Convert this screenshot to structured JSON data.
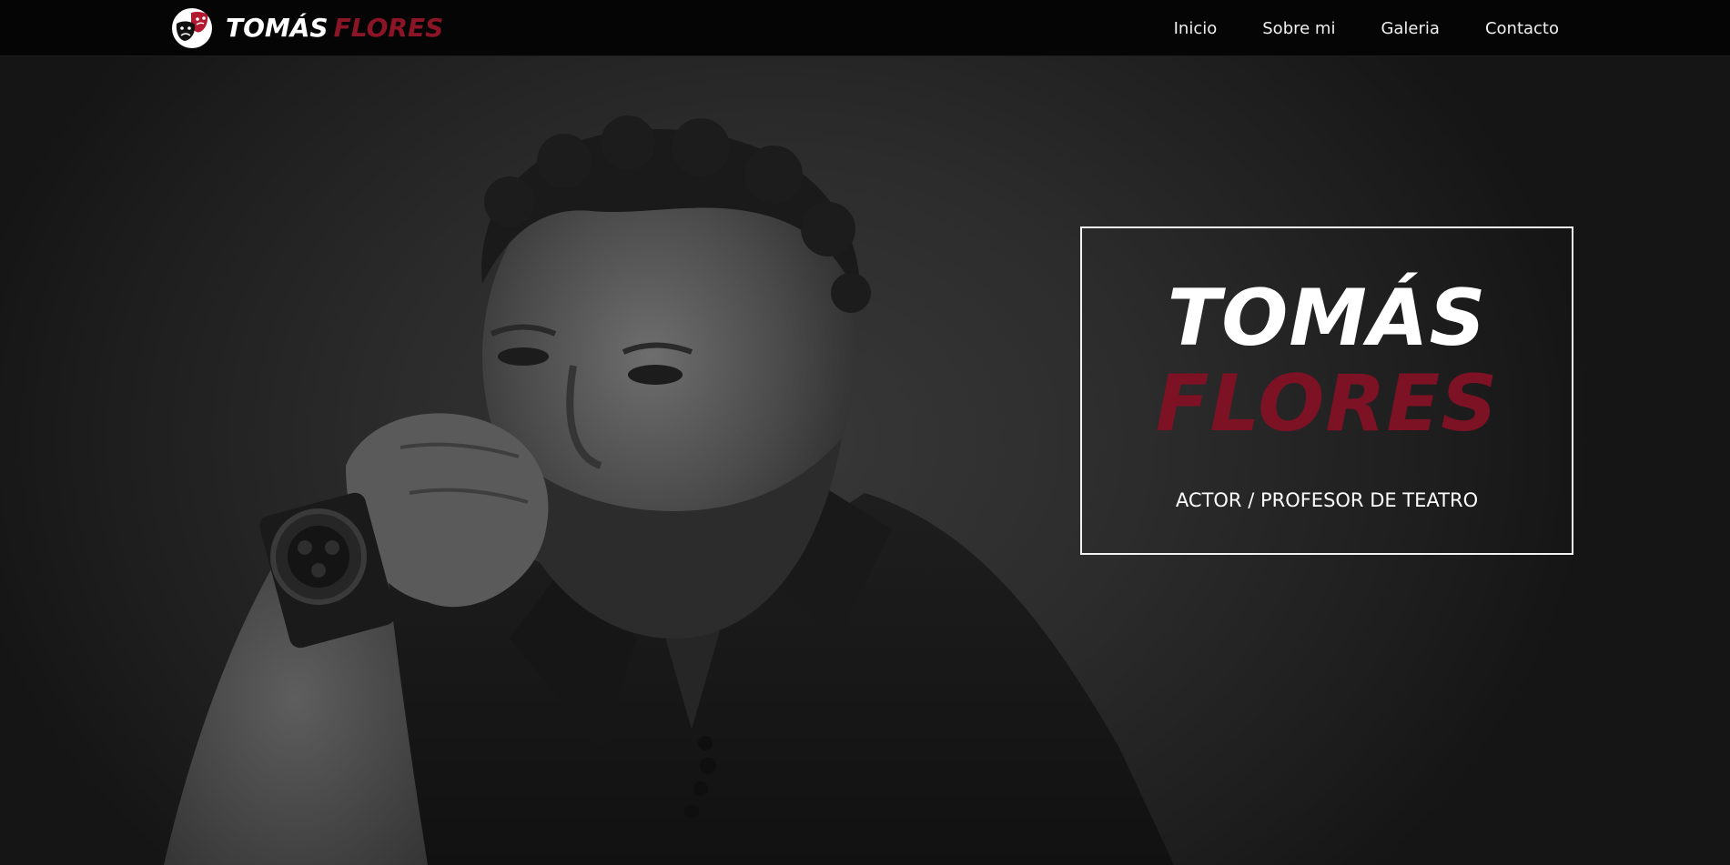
{
  "colors": {
    "navbar_bg": "#050505",
    "accent": "#8b1426",
    "text": "#ffffff",
    "hero_bg": "#2a2a2a"
  },
  "navbar": {
    "brand": {
      "logo_icon": "theater-masks-icon",
      "first_name": "TOMÁS",
      "last_name": "FLORES"
    },
    "links": [
      {
        "label": "Inicio"
      },
      {
        "label": "Sobre mi"
      },
      {
        "label": "Galeria"
      },
      {
        "label": "Contacto"
      }
    ]
  },
  "hero": {
    "photo": "portrait-photo",
    "title_first": "TOMÁS",
    "title_last": "FLORES",
    "subtitle": "ACTOR / PROFESOR DE TEATRO"
  }
}
